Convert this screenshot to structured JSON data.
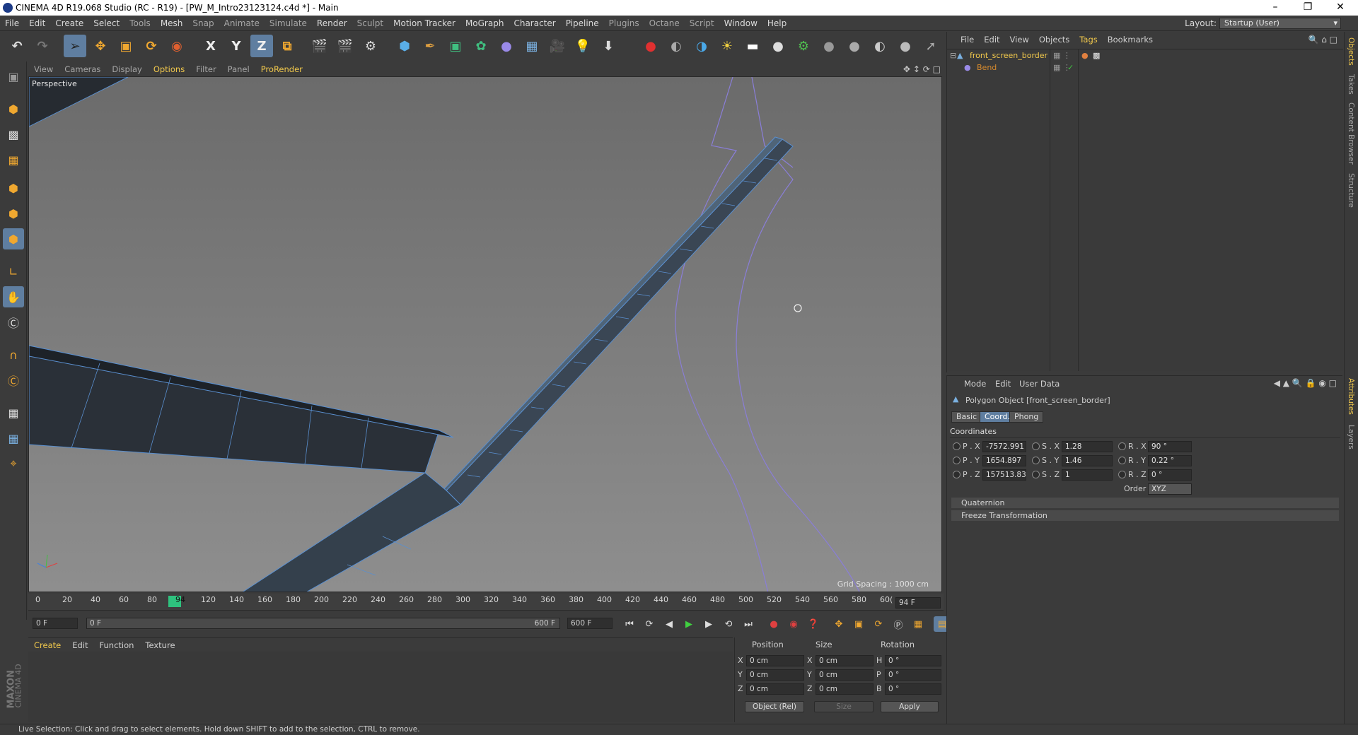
{
  "window": {
    "title": "CINEMA 4D R19.068 Studio (RC - R19) - [PW_M_Intro23123124.c4d *] - Main",
    "minimize_icon": "minimize-icon",
    "restore_icon": "restore-icon",
    "close_icon": "close-icon"
  },
  "menubar": {
    "items": [
      "File",
      "Edit",
      "Create",
      "Select",
      "Tools",
      "Mesh",
      "Snap",
      "Animate",
      "Simulate",
      "Render",
      "Sculpt",
      "Motion Tracker",
      "MoGraph",
      "Character",
      "Pipeline",
      "Plugins",
      "Octane",
      "Script",
      "Window",
      "Help"
    ],
    "layout_label": "Layout:",
    "layout_value": "Startup (User)"
  },
  "toolbar": {
    "axis_x": "X",
    "axis_y": "Y",
    "axis_z": "Z"
  },
  "viewport": {
    "menu": [
      "View",
      "Cameras",
      "Display",
      "Options",
      "Filter",
      "Panel",
      "ProRender"
    ],
    "active_menu": "Options",
    "label": "Perspective",
    "grid_spacing": "Grid Spacing : 1000 cm"
  },
  "timeline": {
    "ticks": [
      "0",
      "20",
      "40",
      "60",
      "80",
      "94",
      "120",
      "140",
      "160",
      "180",
      "200",
      "220",
      "240",
      "260",
      "280",
      "300",
      "320",
      "340",
      "360",
      "380",
      "400",
      "420",
      "440",
      "460",
      "480",
      "500",
      "520",
      "540",
      "560",
      "580",
      "60("
    ],
    "current_frame_box": "94 F",
    "start_field": "0 F",
    "range_start": "0 F",
    "range_end": "600 F",
    "end_field": "600 F"
  },
  "material_manager": {
    "menu": [
      "Create",
      "Edit",
      "Function",
      "Texture"
    ],
    "brand_line1": "MAXON",
    "brand_line2": "CINEMA 4D"
  },
  "coordinate_manager": {
    "headers": [
      "Position",
      "Size",
      "Rotation"
    ],
    "rows": [
      {
        "pos_axis": "X",
        "pos": "0 cm",
        "size_axis": "X",
        "size": "0 cm",
        "rot_axis": "H",
        "rot": "0 °"
      },
      {
        "pos_axis": "Y",
        "pos": "0 cm",
        "size_axis": "Y",
        "size": "0 cm",
        "rot_axis": "P",
        "rot": "0 °"
      },
      {
        "pos_axis": "Z",
        "pos": "0 cm",
        "size_axis": "Z",
        "size": "0 cm",
        "rot_axis": "B",
        "rot": "0 °"
      }
    ],
    "mode_select": "Object (Rel)",
    "size_select": "Size",
    "apply_label": "Apply"
  },
  "status_bar": {
    "text": "Live Selection: Click and drag to select elements. Hold down SHIFT to add to the selection, CTRL to remove."
  },
  "object_manager": {
    "menu": [
      "File",
      "Edit",
      "View",
      "Objects",
      "Tags",
      "Bookmarks"
    ],
    "active_menu": "Tags",
    "objects": [
      {
        "name": "front_screen_border",
        "color": "#f2c94c",
        "icon": "polygon-object-icon"
      },
      {
        "name": "Bend",
        "color": "#d68a2e",
        "icon": "bend-deformer-icon"
      }
    ]
  },
  "attributes_manager": {
    "menu": [
      "Mode",
      "Edit",
      "User Data"
    ],
    "object_title": "Polygon Object [front_screen_border]",
    "tabs": [
      "Basic",
      "Coord.",
      "Phong"
    ],
    "active_tab": "Coord.",
    "section_title": "Coordinates",
    "coords": [
      {
        "p_label": "P . X",
        "p_value": "-7572.991",
        "s_label": "S . X",
        "s_value": "1.28",
        "r_label": "R . X",
        "r_value": "90 °"
      },
      {
        "p_label": "P . Y",
        "p_value": "1654.897",
        "s_label": "S . Y",
        "s_value": "1.46",
        "r_label": "R . Y",
        "r_value": "0.22 °"
      },
      {
        "p_label": "P . Z",
        "p_value": "157513.83",
        "s_label": "S . Z",
        "s_value": "1",
        "r_label": "R . Z",
        "r_value": "0 °"
      }
    ],
    "order_label": "Order",
    "order_value": "XYZ",
    "sections": [
      "Quaternion",
      "Freeze Transformation"
    ]
  },
  "side_tabs": [
    "Objects",
    "Takes",
    "Content Browser",
    "Structure",
    "Attributes",
    "Layers"
  ],
  "colors": {
    "accent": "#f2c94c",
    "selected_tool": "#5f7ea0",
    "frame_marker": "#2ec27e"
  }
}
